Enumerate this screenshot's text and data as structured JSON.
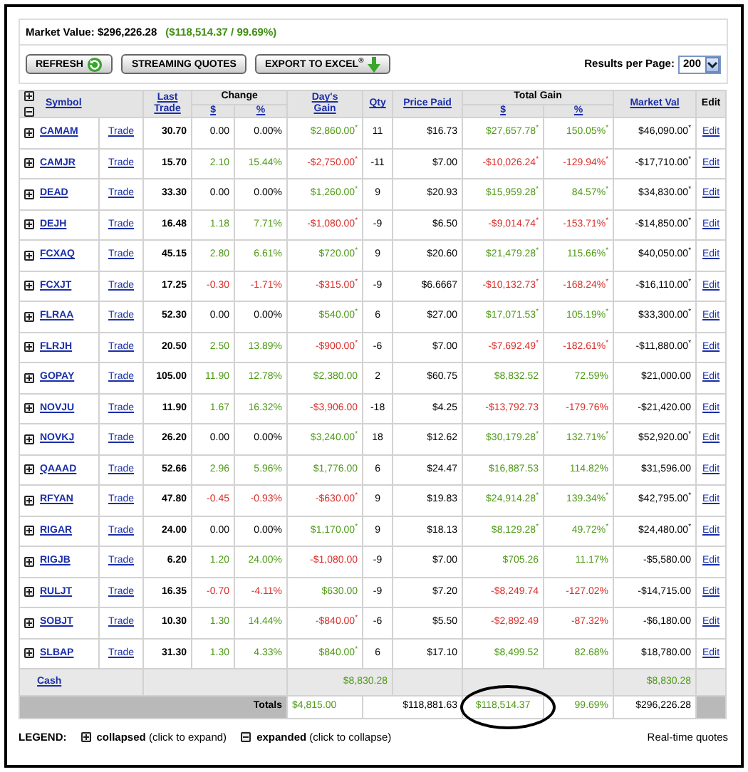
{
  "summary": {
    "label": "Market Value: $296,226.28",
    "gain": "($118,514.37 / 99.69%)"
  },
  "buttons": [
    {
      "label": "REFRESH",
      "kind": "refresh"
    },
    {
      "label": "STREAMING QUOTES",
      "kind": "plain"
    },
    {
      "label": "EXPORT TO EXCEL$^{®}$",
      "kind": "export"
    }
  ],
  "results_per_page": {
    "label": "Results per Page:",
    "value": "200"
  },
  "table": {
    "columns": {
      "symbol": "Symbol",
      "last_trade": "Last Trade",
      "change": "Change",
      "change_dollar": "$",
      "change_pct": "%",
      "days_gain": "Day's Gain",
      "qty": "Qty",
      "price_paid": "Price Paid",
      "total_gain": "Total Gain",
      "total_dollar": "$",
      "total_pct": "%",
      "market_val": "Market Val",
      "edit": "Edit"
    },
    "rows": [
      {
        "symbol": "CAMAM",
        "expanded": false,
        "trade": "Trade",
        "last": "30.70",
        "change": {
          "dollar": "0.00",
          "pct": "0.00%",
          "color": "#000000"
        },
        "days_gain": {
          "text": "$2,860.00$^{*}$",
          "color": "#4f9a18"
        },
        "qty": "11",
        "paid": "$16.73",
        "total_gain": {
          "dollar": "$27,657.78$^{*}$",
          "pct": "150.05%$^{*}$",
          "color": "#4f9a18"
        },
        "value": "$46,090.00$^{*}$",
        "edit": "Edit"
      },
      {
        "symbol": "CAMJR",
        "expanded": false,
        "trade": "Trade",
        "last": "15.70",
        "change": {
          "dollar": "2.10",
          "pct": "15.44%",
          "color": "#4f9a18"
        },
        "days_gain": {
          "text": "-$2,750.00$^{*}$",
          "color": "#d9302c"
        },
        "qty": "-11",
        "paid": "$7.00",
        "total_gain": {
          "dollar": "-$10,026.24$^{*}$",
          "pct": "-129.94%$^{*}$",
          "color": "#d9302c"
        },
        "value": "-$17,710.00$^{*}$",
        "edit": "Edit"
      },
      {
        "symbol": "DEAD",
        "expanded": false,
        "trade": "Trade",
        "last": "33.30",
        "change": {
          "dollar": "0.00",
          "pct": "0.00%",
          "color": "#000000"
        },
        "days_gain": {
          "text": "$1,260.00$^{*}$",
          "color": "#4f9a18"
        },
        "qty": "9",
        "paid": "$20.93",
        "total_gain": {
          "dollar": "$15,959.28$^{*}$",
          "pct": "84.57%$^{*}$",
          "color": "#4f9a18"
        },
        "value": "$34,830.00$^{*}$",
        "edit": "Edit"
      },
      {
        "symbol": "DEJH",
        "expanded": false,
        "trade": "Trade",
        "last": "16.48",
        "change": {
          "dollar": "1.18",
          "pct": "7.71%",
          "color": "#4f9a18"
        },
        "days_gain": {
          "text": "-$1,080.00$^{*}$",
          "color": "#d9302c"
        },
        "qty": "-9",
        "paid": "$6.50",
        "total_gain": {
          "dollar": "-$9,014.74$^{*}$",
          "pct": "-153.71%$^{*}$",
          "color": "#d9302c"
        },
        "value": "-$14,850.00$^{*}$",
        "edit": "Edit"
      },
      {
        "symbol": "FCXAQ",
        "expanded": false,
        "trade": "Trade",
        "last": "45.15",
        "change": {
          "dollar": "2.80",
          "pct": "6.61%",
          "color": "#4f9a18"
        },
        "days_gain": {
          "text": "$720.00$^{*}$",
          "color": "#4f9a18"
        },
        "qty": "9",
        "paid": "$20.60",
        "total_gain": {
          "dollar": "$21,479.28$^{*}$",
          "pct": "115.66%$^{*}$",
          "color": "#4f9a18"
        },
        "value": "$40,050.00$^{*}$",
        "edit": "Edit"
      },
      {
        "symbol": "FCXJT",
        "expanded": false,
        "trade": "Trade",
        "last": "17.25",
        "change": {
          "dollar": "-0.30",
          "pct": "-1.71%",
          "color": "#d9302c"
        },
        "days_gain": {
          "text": "-$315.00$^{*}$",
          "color": "#d9302c"
        },
        "qty": "-9",
        "paid": "$6.6667",
        "total_gain": {
          "dollar": "-$10,132.73$^{*}$",
          "pct": "-168.24%$^{*}$",
          "color": "#d9302c"
        },
        "value": "-$16,110.00$^{*}$",
        "edit": "Edit"
      },
      {
        "symbol": "FLRAA",
        "expanded": false,
        "trade": "Trade",
        "last": "52.30",
        "change": {
          "dollar": "0.00",
          "pct": "0.00%",
          "color": "#000000"
        },
        "days_gain": {
          "text": "$540.00$^{*}$",
          "color": "#4f9a18"
        },
        "qty": "6",
        "paid": "$27.00",
        "total_gain": {
          "dollar": "$17,071.53$^{*}$",
          "pct": "105.19%$^{*}$",
          "color": "#4f9a18"
        },
        "value": "$33,300.00$^{*}$",
        "edit": "Edit"
      },
      {
        "symbol": "FLRJH",
        "expanded": false,
        "trade": "Trade",
        "last": "20.50",
        "change": {
          "dollar": "2.50",
          "pct": "13.89%",
          "color": "#4f9a18"
        },
        "days_gain": {
          "text": "-$900.00$^{*}$",
          "color": "#d9302c"
        },
        "qty": "-6",
        "paid": "$7.00",
        "total_gain": {
          "dollar": "-$7,692.49$^{*}$",
          "pct": "-182.61%$^{*}$",
          "color": "#d9302c"
        },
        "value": "-$11,880.00$^{*}$",
        "edit": "Edit"
      },
      {
        "symbol": "GOPAY",
        "expanded": false,
        "trade": "Trade",
        "last": "105.00",
        "change": {
          "dollar": "11.90",
          "pct": "12.78%",
          "color": "#4f9a18"
        },
        "days_gain": {
          "text": "$2,380.00",
          "color": "#4f9a18"
        },
        "qty": "2",
        "paid": "$60.75",
        "total_gain": {
          "dollar": "$8,832.52",
          "pct": "72.59%",
          "color": "#4f9a18"
        },
        "value": "$21,000.00",
        "edit": "Edit"
      },
      {
        "symbol": "NOVJU",
        "expanded": false,
        "trade": "Trade",
        "last": "11.90",
        "change": {
          "dollar": "1.67",
          "pct": "16.32%",
          "color": "#4f9a18"
        },
        "days_gain": {
          "text": "-$3,906.00",
          "color": "#d9302c"
        },
        "qty": "-18",
        "paid": "$4.25",
        "total_gain": {
          "dollar": "-$13,792.73",
          "pct": "-179.76%",
          "color": "#d9302c"
        },
        "value": "-$21,420.00",
        "edit": "Edit"
      },
      {
        "symbol": "NOVKJ",
        "expanded": false,
        "trade": "Trade",
        "last": "26.20",
        "change": {
          "dollar": "0.00",
          "pct": "0.00%",
          "color": "#000000"
        },
        "days_gain": {
          "text": "$3,240.00$^{*}$",
          "color": "#4f9a18"
        },
        "qty": "18",
        "paid": "$12.62",
        "total_gain": {
          "dollar": "$30,179.28$^{*}$",
          "pct": "132.71%$^{*}$",
          "color": "#4f9a18"
        },
        "value": "$52,920.00$^{*}$",
        "edit": "Edit"
      },
      {
        "symbol": "QAAAD",
        "expanded": false,
        "trade": "Trade",
        "last": "52.66",
        "change": {
          "dollar": "2.96",
          "pct": "5.96%",
          "color": "#4f9a18"
        },
        "days_gain": {
          "text": "$1,776.00",
          "color": "#4f9a18"
        },
        "qty": "6",
        "paid": "$24.47",
        "total_gain": {
          "dollar": "$16,887.53",
          "pct": "114.82%",
          "color": "#4f9a18"
        },
        "value": "$31,596.00",
        "edit": "Edit"
      },
      {
        "symbol": "RFYAN",
        "expanded": false,
        "trade": "Trade",
        "last": "47.80",
        "change": {
          "dollar": "-0.45",
          "pct": "-0.93%",
          "color": "#d9302c"
        },
        "days_gain": {
          "text": "-$630.00$^{*}$",
          "color": "#d9302c"
        },
        "qty": "9",
        "paid": "$19.83",
        "total_gain": {
          "dollar": "$24,914.28$^{*}$",
          "pct": "139.34%$^{*}$",
          "color": "#4f9a18"
        },
        "value": "$42,795.00$^{*}$",
        "edit": "Edit"
      },
      {
        "symbol": "RIGAR",
        "expanded": false,
        "trade": "Trade",
        "last": "24.00",
        "change": {
          "dollar": "0.00",
          "pct": "0.00%",
          "color": "#000000"
        },
        "days_gain": {
          "text": "$1,170.00$^{*}$",
          "color": "#4f9a18"
        },
        "qty": "9",
        "paid": "$18.13",
        "total_gain": {
          "dollar": "$8,129.28$^{*}$",
          "pct": "49.72%$^{*}$",
          "color": "#4f9a18"
        },
        "value": "$24,480.00$^{*}$",
        "edit": "Edit"
      },
      {
        "symbol": "RIGJB",
        "expanded": false,
        "trade": "Trade",
        "last": "6.20",
        "change": {
          "dollar": "1.20",
          "pct": "24.00%",
          "color": "#4f9a18"
        },
        "days_gain": {
          "text": "-$1,080.00",
          "color": "#d9302c"
        },
        "qty": "-9",
        "paid": "$7.00",
        "total_gain": {
          "dollar": "$705.26",
          "pct": "11.17%",
          "color": "#4f9a18"
        },
        "value": "-$5,580.00",
        "edit": "Edit"
      },
      {
        "symbol": "RULJT",
        "expanded": false,
        "trade": "Trade",
        "last": "16.35",
        "change": {
          "dollar": "-0.70",
          "pct": "-4.11%",
          "color": "#d9302c"
        },
        "days_gain": {
          "text": "$630.00",
          "color": "#4f9a18"
        },
        "qty": "-9",
        "paid": "$7.20",
        "total_gain": {
          "dollar": "-$8,249.74",
          "pct": "-127.02%",
          "color": "#d9302c"
        },
        "value": "-$14,715.00",
        "edit": "Edit"
      },
      {
        "symbol": "SOBJT",
        "expanded": false,
        "trade": "Trade",
        "last": "10.30",
        "change": {
          "dollar": "1.30",
          "pct": "14.44%",
          "color": "#4f9a18"
        },
        "days_gain": {
          "text": "-$840.00$^{*}$",
          "color": "#d9302c"
        },
        "qty": "-6",
        "paid": "$5.50",
        "total_gain": {
          "dollar": "-$2,892.49",
          "pct": "-87.32%",
          "color": "#d9302c"
        },
        "value": "-$6,180.00",
        "edit": "Edit"
      },
      {
        "symbol": "SLBAP",
        "expanded": false,
        "trade": "Trade",
        "last": "31.30",
        "change": {
          "dollar": "1.30",
          "pct": "4.33%",
          "color": "#4f9a18"
        },
        "days_gain": {
          "text": "$840.00$^{*}$",
          "color": "#4f9a18"
        },
        "qty": "6",
        "paid": "$17.10",
        "total_gain": {
          "dollar": "$8,499.52",
          "pct": "82.68%",
          "color": "#4f9a18"
        },
        "value": "$18,780.00",
        "edit": "Edit"
      }
    ],
    "cash": {
      "label": "Cash",
      "days_gain": "$8,830.28",
      "market_val": "$8,830.28"
    },
    "totals": {
      "label": "Totals",
      "days_gain": "$4,815.00",
      "price_paid": "$118,881.63",
      "total_gain": "$118,514.37",
      "circled": true,
      "total_pct": "99.69%",
      "market_val": "$296,226.28"
    }
  },
  "legend": {
    "label": "LEGEND:",
    "items": [
      {
        "expanded": false,
        "text": "**collapsed** (click to expand)"
      },
      {
        "expanded": true,
        "text": "**expanded** (click to collapse)"
      }
    ]
  },
  "footer_note": "Real-time quotes"
}
